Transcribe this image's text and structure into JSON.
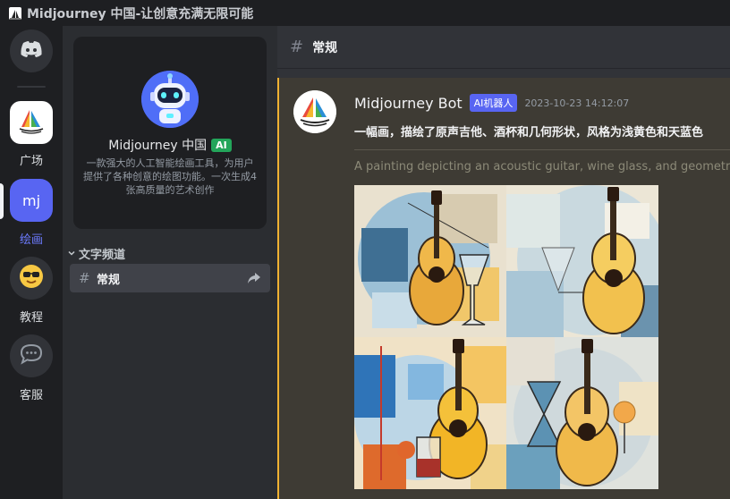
{
  "window": {
    "title": "Midjourney 中国-让创意充满无限可能"
  },
  "rail": {
    "items": [
      {
        "label": "",
        "icon": "discord-icon"
      },
      {
        "label": "广场",
        "icon": "midjourney-logo-icon"
      },
      {
        "label": "绘画",
        "icon": "mj-text-icon",
        "text": "mj",
        "active": true
      },
      {
        "label": "教程",
        "icon": "sunglasses-emoji-icon"
      },
      {
        "label": "客服",
        "icon": "chat-bubble-icon"
      }
    ]
  },
  "server": {
    "name": "Midjourney 中国",
    "badge": "AI",
    "description": "一款强大的人工智能绘画工具，为用户提供了各种创意的绘图功能。一次生成4张高质量的艺术创作"
  },
  "sidebar": {
    "category": "文字频道",
    "channel": {
      "hash": "#",
      "name": "常规"
    }
  },
  "header": {
    "hash": "#",
    "channel_name": "常规"
  },
  "message": {
    "author": "Midjourney Bot",
    "badge": "AI机器人",
    "timestamp": "2023-10-23 14:12:07",
    "text_cn": "一幅画，描绘了原声吉他、酒杯和几何形状，风格为浅黄色和天蓝色",
    "text_en": "A painting depicting an acoustic guitar, wine glass, and geometric"
  },
  "colors": {
    "accent": "#5865f2",
    "active_label": "#6c7bff",
    "ai_badge": "#23a55a",
    "highlight_bar": "#f0b232"
  }
}
